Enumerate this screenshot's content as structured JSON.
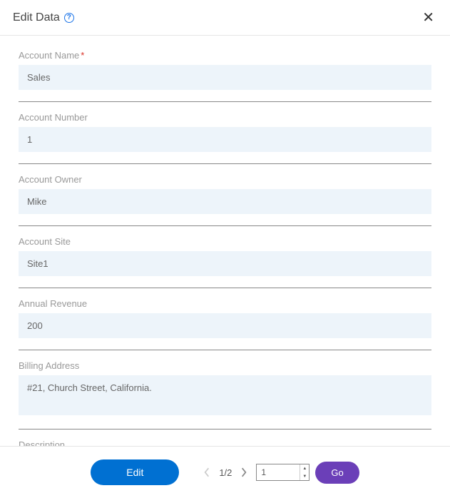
{
  "header": {
    "title": "Edit Data",
    "help_glyph": "?",
    "close_glyph": "✕"
  },
  "fields": {
    "account_name": {
      "label": "Account Name",
      "required": true,
      "value": "Sales"
    },
    "account_number": {
      "label": "Account Number",
      "required": false,
      "value": "1"
    },
    "account_owner": {
      "label": "Account Owner",
      "required": false,
      "value": "Mike"
    },
    "account_site": {
      "label": "Account Site",
      "required": false,
      "value": "Site1"
    },
    "annual_revenue": {
      "label": "Annual Revenue",
      "required": false,
      "value": "200"
    },
    "billing_address": {
      "label": "Billing Address",
      "required": false,
      "value": "#21, Church Street, California."
    },
    "description": {
      "label": "Description",
      "required": false,
      "value": ""
    }
  },
  "footer": {
    "edit_label": "Edit",
    "pager_text": "1/2",
    "page_input_value": "1",
    "go_label": "Go"
  }
}
